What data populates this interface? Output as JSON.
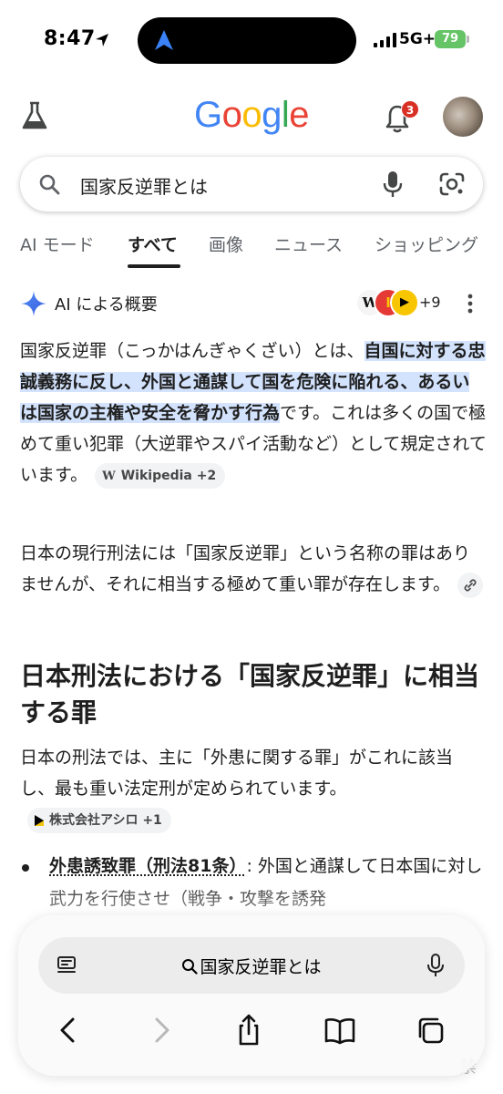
{
  "status_bar": {
    "time": "8:47",
    "network": "5G+",
    "battery": "79"
  },
  "header": {
    "logo_letters": [
      {
        "ch": "G",
        "color": "#4285F4"
      },
      {
        "ch": "o",
        "color": "#EA4335"
      },
      {
        "ch": "o",
        "color": "#FBBC05"
      },
      {
        "ch": "g",
        "color": "#4285F4"
      },
      {
        "ch": "l",
        "color": "#34A853"
      },
      {
        "ch": "e",
        "color": "#EA4335"
      }
    ],
    "notification_count": "3"
  },
  "search": {
    "query": "国家反逆罪とは"
  },
  "tabs": [
    "AI モード",
    "すべて",
    "画像",
    "ニュース",
    "ショッピング"
  ],
  "ai_overview": {
    "title": "AI による概要",
    "sources_more": "+9",
    "source_icons": [
      "W",
      "I",
      "▶"
    ],
    "p1_prefix": "国家反逆罪（こっかはんぎゃくざい）とは、",
    "p1_highlight": "自国に対する忠誠義務に反し、外国と通謀して国を危険に陥れる、あるいは国家の主権や安全を脅かす行為",
    "p1_suffix": "です。これは多くの国で極めて重い犯罪（大逆罪やスパイ活動など）として規定されています。",
    "p1_chip": "Wikipedia +2",
    "p2": "日本の現行刑法には「国家反逆罪」という名称の罪はありませんが、それに相当する極めて重い罪が存在します。",
    "heading": "日本刑法における「国家反逆罪」に相当する罪",
    "p3": "日本の刑法では、主に「外患に関する罪」がこれに該当し、最も重い法定刑が定められています。",
    "p3_chip": "株式会社アシロ +1",
    "bullet_term": "外患誘致罪（刑法81条）",
    "bullet_text": ": 外国と通謀して日本国に対し武力を行使させ（戦争・攻撃を誘発",
    "tail": "禁"
  },
  "safari": {
    "url_text": "国家反逆罪とは"
  },
  "colors": {
    "highlight": "#d3e3fd",
    "battery": "#65c466",
    "badge": "#d93025"
  }
}
